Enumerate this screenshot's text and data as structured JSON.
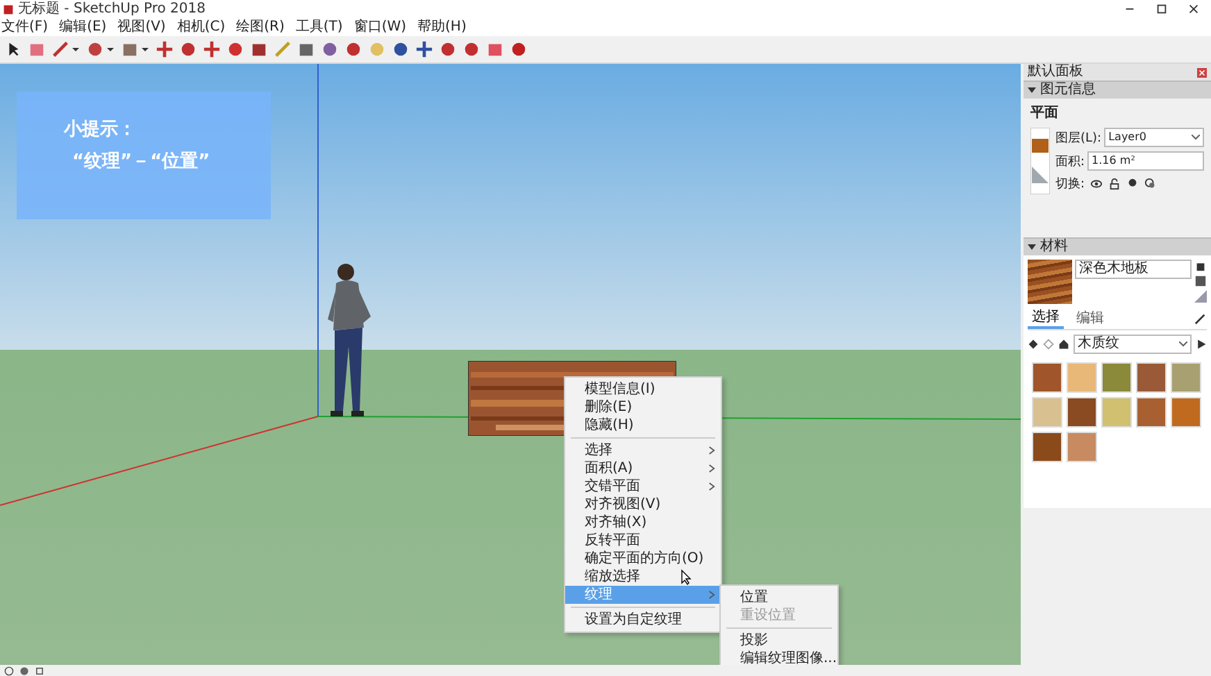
{
  "window": {
    "title": "无标题 - SketchUp Pro 2018"
  },
  "menu_bar": [
    "文件(F)",
    "编辑(E)",
    "视图(V)",
    "相机(C)",
    "绘图(R)",
    "工具(T)",
    "窗口(W)",
    "帮助(H)"
  ],
  "tip": {
    "title": "小提示：",
    "text": "“纹理”－“位置”"
  },
  "context_menu": [
    {
      "kind": "item",
      "label": "模型信息(I)",
      "selected": false
    },
    {
      "kind": "item",
      "label": "删除(E)",
      "selected": false
    },
    {
      "kind": "item",
      "label": "隐藏(H)",
      "selected": false
    },
    {
      "kind": "separator"
    },
    {
      "kind": "submenu",
      "label": "选择",
      "selected": false
    },
    {
      "kind": "submenu",
      "label": "面积(A)",
      "selected": false
    },
    {
      "kind": "submenu",
      "label": "交错平面",
      "selected": false
    },
    {
      "kind": "item",
      "label": "对齐视图(V)",
      "selected": false
    },
    {
      "kind": "item",
      "label": "对齐轴(X)",
      "selected": false
    },
    {
      "kind": "item",
      "label": "反转平面",
      "selected": false
    },
    {
      "kind": "item",
      "label": "确定平面的方向(O)",
      "selected": false
    },
    {
      "kind": "item",
      "label": "缩放选择",
      "selected": false
    },
    {
      "kind": "submenu",
      "label": "纹理",
      "selected": true
    },
    {
      "kind": "separator"
    },
    {
      "kind": "item",
      "label": "设置为自定纹理",
      "selected": false
    }
  ],
  "submenu": [
    {
      "kind": "item",
      "label": "位置",
      "disabled": false
    },
    {
      "kind": "item",
      "label": "重设位置",
      "disabled": true
    },
    {
      "kind": "separator"
    },
    {
      "kind": "item",
      "label": "投影",
      "disabled": false
    },
    {
      "kind": "item",
      "label": "编辑纹理图像...",
      "disabled": false
    }
  ],
  "panel": {
    "title": "默认面板",
    "entity_info": {
      "header": "图元信息",
      "expanded": true,
      "type": "平面",
      "layer_label": "图层(L):",
      "layer": "Layer0",
      "area_label": "面积:",
      "area": "1.16 m²",
      "toggle_label": "切换:"
    },
    "materials": {
      "header": "材料",
      "expanded": true,
      "name": "深色木地板",
      "tabs": [
        {
          "label": "选择",
          "selected": true
        },
        {
          "label": "编辑",
          "selected": false
        }
      ],
      "library": "木质纹",
      "swatches": [
        {
          "color": "#a0552a"
        },
        {
          "color": "#e8b878"
        },
        {
          "color": "#8a8a3a"
        },
        {
          "color": "#9a5a38"
        },
        {
          "color": "#a8a070"
        },
        {
          "color": "#d8c090"
        },
        {
          "color": "#8a4a22"
        },
        {
          "color": "#d0c070"
        },
        {
          "color": "#a86030"
        },
        {
          "color": "#c06a20"
        },
        {
          "color": "#8a4a1a"
        },
        {
          "color": "#c88a60"
        }
      ]
    }
  }
}
